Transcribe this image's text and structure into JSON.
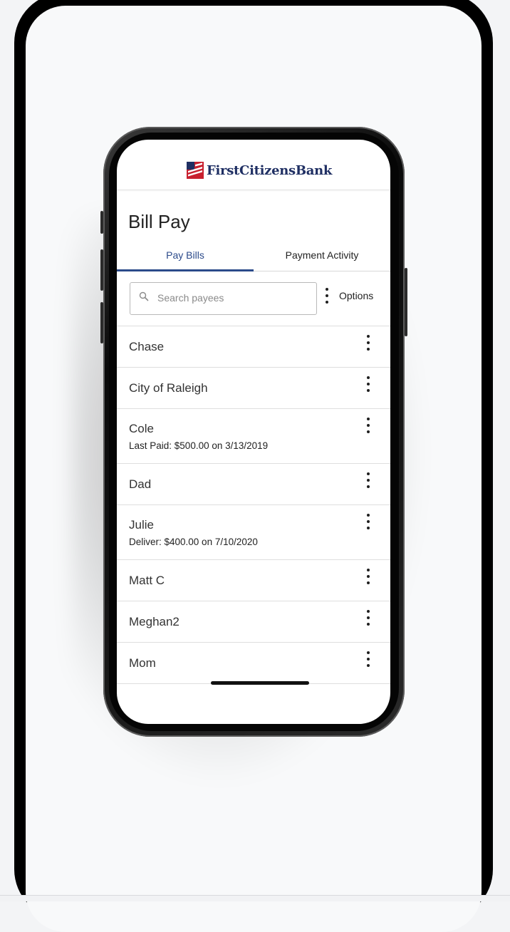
{
  "brand": {
    "name": "FirstCitizensBank",
    "color": "#1f2f63",
    "accent": "#c8202f"
  },
  "page": {
    "title": "Bill Pay"
  },
  "tabs": [
    {
      "label": "Pay Bills",
      "active": true
    },
    {
      "label": "Payment Activity",
      "active": false
    }
  ],
  "search": {
    "placeholder": "Search payees"
  },
  "options": {
    "label": "Options"
  },
  "payees": [
    {
      "name": "Chase",
      "detail": ""
    },
    {
      "name": "City of Raleigh",
      "detail": ""
    },
    {
      "name": "Cole",
      "detail": "Last Paid: $500.00 on 3/13/2019"
    },
    {
      "name": "Dad",
      "detail": ""
    },
    {
      "name": "Julie",
      "detail": "Deliver: $400.00 on 7/10/2020"
    },
    {
      "name": "Matt C",
      "detail": ""
    },
    {
      "name": "Meghan2",
      "detail": ""
    },
    {
      "name": "Mom",
      "detail": ""
    }
  ]
}
